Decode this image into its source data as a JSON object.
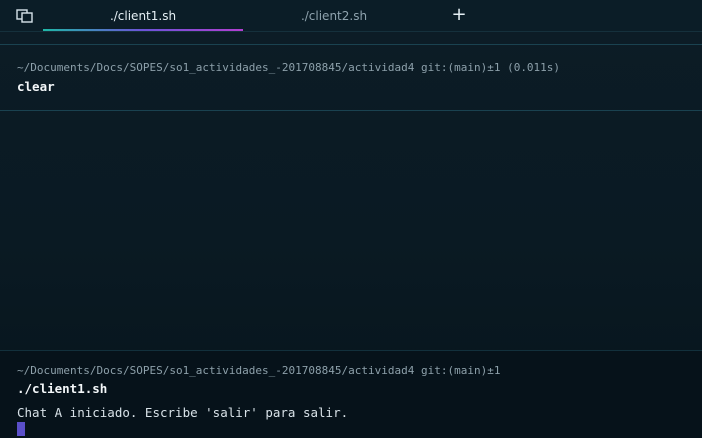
{
  "tabs": [
    {
      "label": "./client1.sh",
      "active": true
    },
    {
      "label": "./client2.sh",
      "active": false
    }
  ],
  "add_tab_label": "+",
  "blocks": [
    {
      "path": "~/Documents/Docs/SOPES/so1_actividades_-201708845/actividad4 git:(main)±1 (0.011s)",
      "command": "clear",
      "output": ""
    },
    {
      "path": "~/Documents/Docs/SOPES/so1_actividades_-201708845/actividad4 git:(main)±1",
      "command": "./client1.sh",
      "output": "Chat A iniciado. Escribe 'salir' para salir."
    }
  ],
  "colors": {
    "background": "#0b1a24",
    "accent_gradient_start": "#1fb7a6",
    "accent_gradient_end": "#b23fd0",
    "cursor": "#5a4fc9"
  }
}
